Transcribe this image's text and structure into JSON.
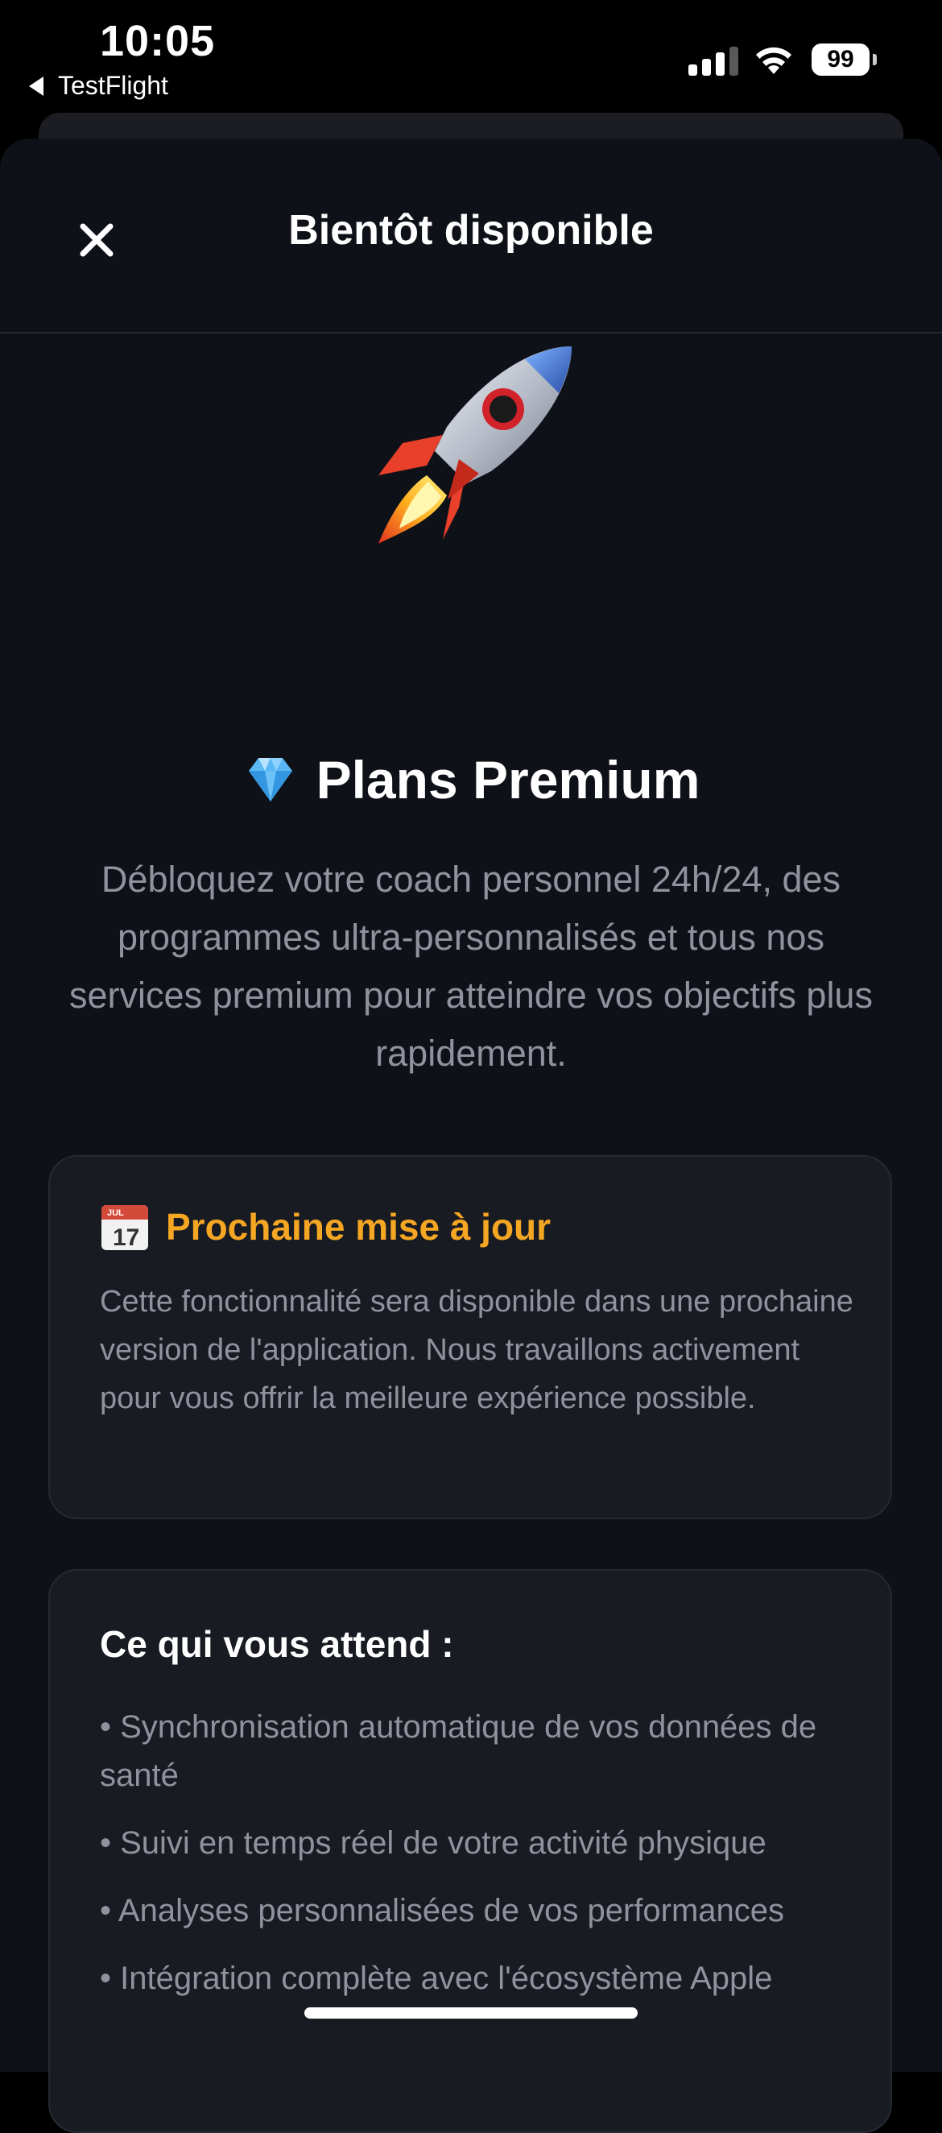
{
  "status_bar": {
    "time": "10:05",
    "back_app": "TestFlight",
    "battery": "99",
    "icons": [
      "cellular-signal-icon",
      "wifi-icon",
      "battery-icon"
    ]
  },
  "header": {
    "title": "Bientôt disponible",
    "close_icon": "close-icon"
  },
  "hero": {
    "icon": "rocket-emoji",
    "title_icon": "diamond-emoji",
    "title": "Plans Premium",
    "description": "Débloquez votre coach personnel 24h/24, des programmes ultra-personnalisés et tous nos services premium pour atteindre vos objectifs plus rapidement."
  },
  "update_card": {
    "icon": "calendar-emoji",
    "title": "Prochaine mise à jour",
    "text": "Cette fonctionnalité sera disponible dans une prochaine version de l'application. Nous travaillons activement pour vous offrir la meilleure expérience possible."
  },
  "features_card": {
    "title": "Ce qui vous attend :",
    "items": [
      "• Synchronisation automatique de vos données de santé",
      "• Suivi en temps réel de votre activité physique",
      "• Analyses personnalisées de vos performances",
      "• Intégration complète avec l'écosystème Apple"
    ]
  },
  "colors": {
    "background": "#0e1117",
    "card": "#181b22",
    "accent": "#f5a623",
    "muted_text": "#8e939d"
  }
}
